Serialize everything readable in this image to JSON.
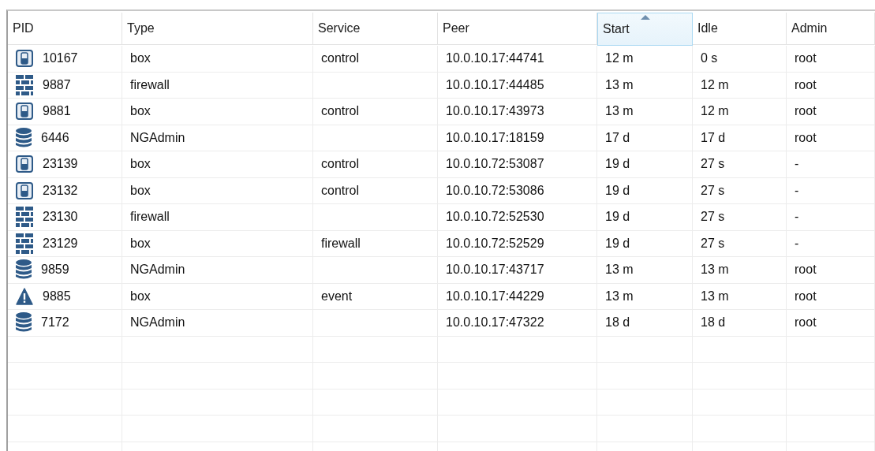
{
  "table": {
    "columns": [
      {
        "label": "PID",
        "sorted": false
      },
      {
        "label": "Type",
        "sorted": false
      },
      {
        "label": "Service",
        "sorted": false
      },
      {
        "label": "Peer",
        "sorted": false
      },
      {
        "label": "Start",
        "sorted": true
      },
      {
        "label": "Idle",
        "sorted": false
      },
      {
        "label": "Admin",
        "sorted": false
      }
    ],
    "rows": [
      {
        "kind": "box",
        "pid": "10167",
        "type": "box",
        "service": "control",
        "peer": "10.0.10.17:44741",
        "start": "12 m",
        "idle": "0 s",
        "admin": "root"
      },
      {
        "kind": "firewall",
        "pid": "9887",
        "type": "firewall",
        "service": "",
        "peer": "10.0.10.17:44485",
        "start": "13 m",
        "idle": "12 m",
        "admin": "root"
      },
      {
        "kind": "box",
        "pid": "9881",
        "type": "box",
        "service": "control",
        "peer": "10.0.10.17:43973",
        "start": "13 m",
        "idle": "12 m",
        "admin": "root"
      },
      {
        "kind": "database",
        "pid": "6446",
        "type": "NGAdmin",
        "service": "",
        "peer": "10.0.10.17:18159",
        "start": "17 d",
        "idle": "17 d",
        "admin": "root"
      },
      {
        "kind": "box",
        "pid": "23139",
        "type": "box",
        "service": "control",
        "peer": "10.0.10.72:53087",
        "start": "19 d",
        "idle": "27 s",
        "admin": "-"
      },
      {
        "kind": "box",
        "pid": "23132",
        "type": "box",
        "service": "control",
        "peer": "10.0.10.72:53086",
        "start": "19 d",
        "idle": "27 s",
        "admin": "-"
      },
      {
        "kind": "firewall",
        "pid": "23130",
        "type": "firewall",
        "service": "",
        "peer": "10.0.10.72:52530",
        "start": "19 d",
        "idle": "27 s",
        "admin": "-"
      },
      {
        "kind": "firewall",
        "pid": "23129",
        "type": "box",
        "service": "firewall",
        "peer": "10.0.10.72:52529",
        "start": "19 d",
        "idle": "27 s",
        "admin": "-"
      },
      {
        "kind": "database",
        "pid": "9859",
        "type": "NGAdmin",
        "service": "",
        "peer": "10.0.10.17:43717",
        "start": "13 m",
        "idle": "13 m",
        "admin": "root"
      },
      {
        "kind": "warning",
        "pid": "9885",
        "type": "box",
        "service": "event",
        "peer": "10.0.10.17:44229",
        "start": "13 m",
        "idle": "13 m",
        "admin": "root"
      },
      {
        "kind": "database",
        "pid": "7172",
        "type": "NGAdmin",
        "service": "",
        "peer": "10.0.10.17:47322",
        "start": "18 d",
        "idle": "18 d",
        "admin": "root"
      }
    ]
  }
}
